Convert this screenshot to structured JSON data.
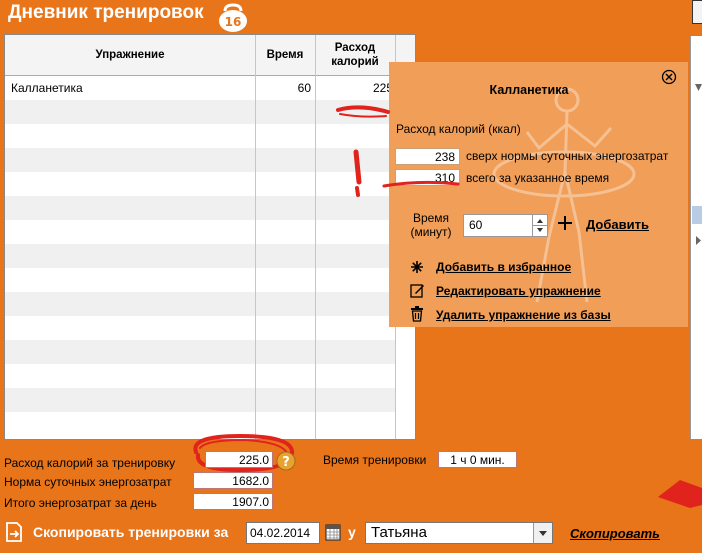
{
  "app": {
    "title": "Дневник тренировок",
    "badge": "16"
  },
  "grid": {
    "columns": [
      "Упражнение",
      "Время",
      "Расход калорий"
    ],
    "rows": [
      {
        "exercise": "Калланетика",
        "time": "60",
        "calories": "225"
      }
    ]
  },
  "popup": {
    "title": "Калланетика",
    "calories_label": "Расход калорий (ккал)",
    "above_norm_value": "238",
    "above_norm_label": "сверх нормы суточных энергозатрат",
    "total_value": "310",
    "total_label": "всего за указанное время",
    "time_label": "Время (минут)",
    "time_value": "60",
    "add_label": "Добавить",
    "favorites_label": "Добавить в избранное",
    "edit_label": "Редактировать упражнение",
    "delete_label": "Удалить упражнение из базы"
  },
  "stats": {
    "calories_label": "Расход калорий за тренировку",
    "calories_value": "225.0",
    "training_time_label": "Время тренировки",
    "training_time_value": "1 ч 0 мин.",
    "norm_label": "Норма суточных энергозатрат",
    "norm_value": "1682.0",
    "total_label": "Итого энергозатрат за день",
    "total_value": "1907.0"
  },
  "copybar": {
    "label": "Скопировать тренировки за",
    "date": "04.02.2014",
    "at_label": "у",
    "user": "Татьяна",
    "copy_link": "Скопировать"
  },
  "colors": {
    "background": "#e8751a",
    "popup": "#f09e58",
    "annotation_red": "#e0231c"
  },
  "icons": [
    "close-icon",
    "plus-icon",
    "star-icon",
    "pencil-icon",
    "trash-icon",
    "calendar-icon",
    "copy-icon",
    "question-icon",
    "chevron-down-icon",
    "kettlebell-icon"
  ]
}
